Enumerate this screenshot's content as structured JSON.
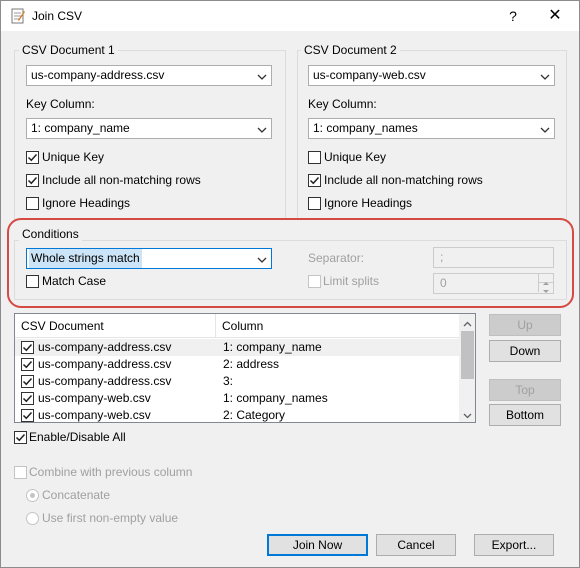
{
  "window": {
    "title": "Join CSV",
    "help_label": "?",
    "close_label": "✕"
  },
  "doc1": {
    "legend": "CSV Document 1",
    "file_value": "us-company-address.csv",
    "key_label": "Key Column:",
    "key_value": "1: company_name",
    "unique_key": {
      "label": "Unique Key",
      "checked": true
    },
    "include_nonmatching": {
      "label": "Include all non-matching rows",
      "checked": true
    },
    "ignore_headings": {
      "label": "Ignore Headings",
      "checked": false
    }
  },
  "doc2": {
    "legend": "CSV Document 2",
    "file_value": "us-company-web.csv",
    "key_label": "Key Column:",
    "key_value": "1: company_names",
    "unique_key": {
      "label": "Unique Key",
      "checked": false
    },
    "include_nonmatching": {
      "label": "Include all non-matching rows",
      "checked": true
    },
    "ignore_headings": {
      "label": "Ignore Headings",
      "checked": false
    }
  },
  "conditions": {
    "legend": "Conditions",
    "match_value": "Whole strings match",
    "match_case_label": "Match Case",
    "separator_label": "Separator:",
    "separator_value": ";",
    "limit_splits_label": "Limit splits",
    "limit_splits_value": "0",
    "highlight_color": "#d64a44"
  },
  "columns": {
    "headers": [
      "CSV Document",
      "Column"
    ],
    "rows": [
      {
        "document": "us-company-address.csv",
        "column": "1: company_name",
        "checked": true
      },
      {
        "document": "us-company-address.csv",
        "column": "2: address",
        "checked": true
      },
      {
        "document": "us-company-address.csv",
        "column": "3:",
        "checked": true
      },
      {
        "document": "us-company-web.csv",
        "column": "1: company_names",
        "checked": true
      },
      {
        "document": "us-company-web.csv",
        "column": "2: Category",
        "checked": true
      }
    ],
    "up_label": "Up",
    "down_label": "Down",
    "top_label": "Top",
    "bottom_label": "Bottom",
    "enable_all_label": "Enable/Disable All"
  },
  "combine": {
    "label": "Combine with previous column",
    "concatenate_label": "Concatenate",
    "first_nonempty_label": "Use first non-empty value"
  },
  "footer": {
    "join_label": "Join Now",
    "cancel_label": "Cancel",
    "export_label": "Export..."
  },
  "icons": {
    "app": "csv-app-icon",
    "dropdown": "chevron-down-icon",
    "check": "checkmark-icon"
  }
}
